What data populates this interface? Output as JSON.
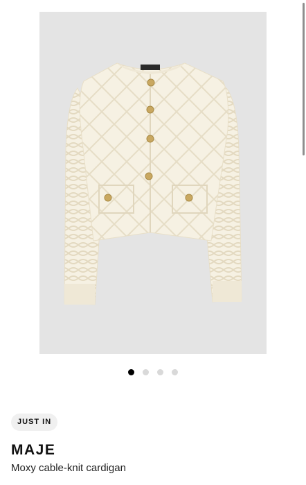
{
  "product": {
    "badge": "JUST IN",
    "brand": "MAJE",
    "name": "Moxy cable-knit cardigan",
    "image": {
      "alt": "Cream cable-knit cardigan with gold buttons",
      "background_color": "#e4e4e4",
      "garment_color": "#f6f1e3",
      "button_color": "#c9a861"
    }
  },
  "carousel": {
    "slide_count": 4,
    "active_index": 0,
    "active_color": "#000000",
    "inactive_color": "#d9d9d9"
  }
}
